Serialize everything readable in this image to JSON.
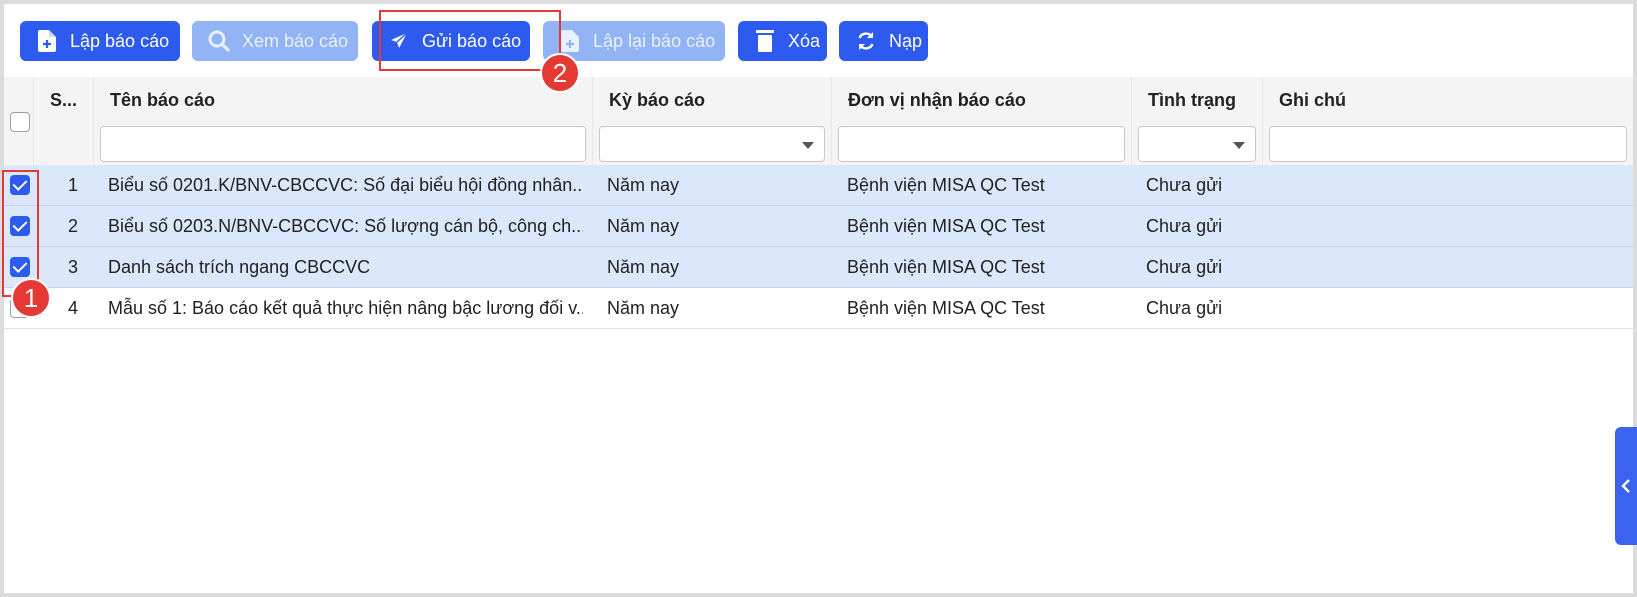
{
  "toolbar": {
    "buttons": [
      {
        "label": "Lập báo cáo",
        "icon": "file-add-icon",
        "enabled": true
      },
      {
        "label": "Xem báo cáo",
        "icon": "search-icon",
        "enabled": false
      },
      {
        "label": "Gửi báo cáo",
        "icon": "send-icon",
        "enabled": true
      },
      {
        "label": "Lập lại báo cáo",
        "icon": "file-add-icon",
        "enabled": false
      },
      {
        "label": "Xóa",
        "icon": "trash-icon",
        "enabled": true
      },
      {
        "label": "Nạp",
        "icon": "refresh-icon",
        "enabled": true
      }
    ]
  },
  "markers": {
    "one": "1",
    "two": "2"
  },
  "table": {
    "columns": [
      "S...",
      "Tên báo cáo",
      "Kỳ báo cáo",
      "Đơn vị nhận báo cáo",
      "Tình trạng",
      "Ghi chú"
    ],
    "rows": [
      {
        "selected": true,
        "stt": "1",
        "name": "Biểu số 0201.K/BNV-CBCCVC: Số đại biểu hội đồng nhân...",
        "period": "Năm nay",
        "unit": "Bệnh viện MISA QC Test",
        "status": "Chưa gửi",
        "note": ""
      },
      {
        "selected": true,
        "stt": "2",
        "name": "Biểu số 0203.N/BNV-CBCCVC: Số lượng cán bộ, công ch...",
        "period": "Năm nay",
        "unit": "Bệnh viện MISA QC Test",
        "status": "Chưa gửi",
        "note": ""
      },
      {
        "selected": true,
        "stt": "3",
        "name": "Danh sách trích ngang CBCCVC",
        "period": "Năm nay",
        "unit": "Bệnh viện MISA QC Test",
        "status": "Chưa gửi",
        "note": ""
      },
      {
        "selected": false,
        "stt": "4",
        "name": "Mẫu số 1: Báo cáo kết quả thực hiện nâng bậc lương đối v...",
        "period": "Năm nay",
        "unit": "Bệnh viện MISA QC Test",
        "status": "Chưa gửi",
        "note": ""
      }
    ]
  },
  "colors": {
    "primary": "#2e5bef",
    "primary_disabled": "#93b4f4",
    "selected_row": "#dbe8fb",
    "highlight": "#e53935"
  }
}
